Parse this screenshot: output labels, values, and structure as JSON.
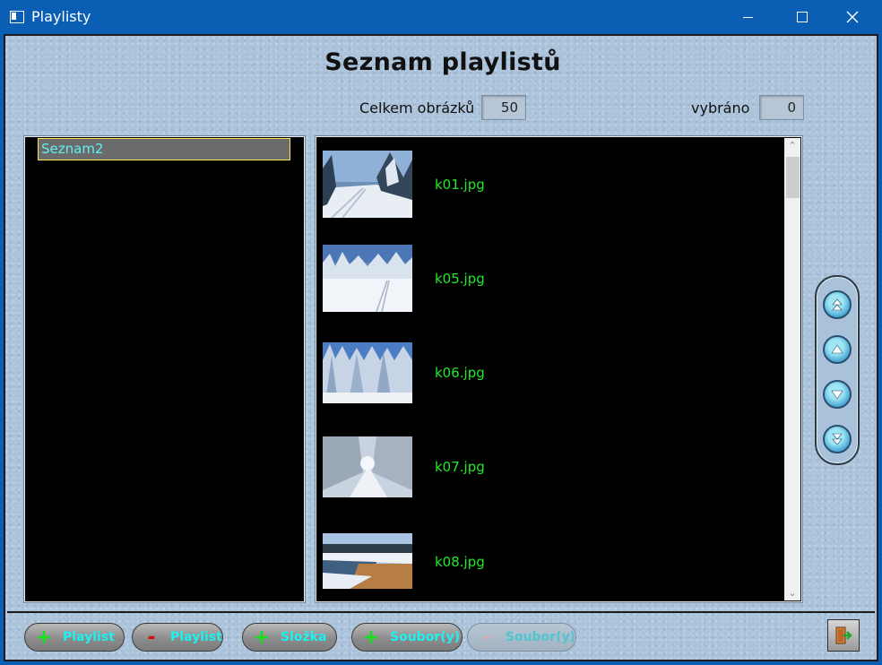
{
  "window": {
    "title": "Playlisty"
  },
  "heading": "Seznam playlistů",
  "stats": {
    "total_label": "Celkem obrázků",
    "total_value": "50",
    "selected_label": "vybráno",
    "selected_value": "0"
  },
  "playlists": [
    {
      "label": "Seznam2",
      "selected": true
    }
  ],
  "files": [
    {
      "name": "k01.jpg",
      "thumb": "snowy-forest-trail-icon"
    },
    {
      "name": "k05.jpg",
      "thumb": "snowy-field-tracks-icon"
    },
    {
      "name": "k06.jpg",
      "thumb": "snow-covered-spruces-icon"
    },
    {
      "name": "k07.jpg",
      "thumb": "snowy-tree-alley-icon"
    },
    {
      "name": "k08.jpg",
      "thumb": "winter-river-icon"
    }
  ],
  "buttons": {
    "add_playlist": "Playlist",
    "remove_playlist": "Playlist",
    "add_folder": "Složka",
    "add_files": "Soubor(y)",
    "remove_files": "Soubor(y)",
    "plus_symbol": "+",
    "minus_symbol": "-"
  },
  "colors": {
    "file_label": "#22e82a",
    "playlist_label": "#5ff0f0",
    "button_text": "#1ff0f0",
    "titlebar": "#0a5fb4"
  }
}
